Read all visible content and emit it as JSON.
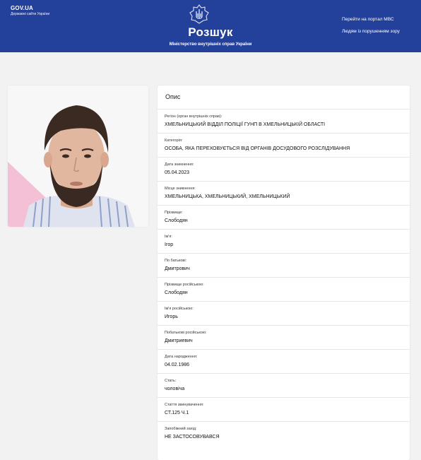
{
  "header": {
    "gov_title": "GOV.UA",
    "gov_subtitle": "Державні сайти України",
    "emblem_icon": "trident-emblem-icon",
    "title": "Розшук",
    "subtitle": "Міністерство внутрішніх справ України",
    "nav": [
      {
        "label": "Перейти на портал МВС"
      },
      {
        "label": "Людям із порушенням зору"
      }
    ],
    "bg_color": "#23409a"
  },
  "photo": {
    "icon": "person-photo"
  },
  "details": {
    "title": "Опис",
    "fields": [
      {
        "label": "Регіон (орган внутрішніх справ):",
        "value": "ХМЕЛЬНИЦЬКИЙ ВІДДІЛ ПОЛІЦІЇ ГУНП В ХМЕЛЬНИЦЬКІЙ ОБЛАСТІ"
      },
      {
        "label": "Категорія:",
        "value": "ОСОБА, ЯКА ПЕРЕХОВУЄТЬСЯ ВІД ОРГАНІВ ДОСУДОВОГО РОЗСЛІДУВАННЯ"
      },
      {
        "label": "Дата зникнення:",
        "value": "05.04.2023"
      },
      {
        "label": "Місце зникнення:",
        "value": "ХМЕЛЬНИЦЬКА, ХМЕЛЬНИЦЬКИЙ, ХМЕЛЬНИЦЬКИЙ"
      },
      {
        "label": "Прізвище:",
        "value": "Слободян"
      },
      {
        "label": "Ім'я:",
        "value": "Ігор"
      },
      {
        "label": "По батькові:",
        "value": "Дмитрович"
      },
      {
        "label": "Прізвище російською:",
        "value": "Слободян"
      },
      {
        "label": "Ім'я російською:",
        "value": "Игорь"
      },
      {
        "label": "Побатькові російською:",
        "value": "Дмитриевич"
      },
      {
        "label": "Дата народження:",
        "value": "04.02.1986"
      },
      {
        "label": "Стать:",
        "value": "чоловіча"
      },
      {
        "label": "Стаття звинувачення:",
        "value": "СТ.125 Ч.1"
      },
      {
        "label": "Запобіжний захід:",
        "value": "НЕ ЗАСТОСОВУВАВСЯ"
      }
    ]
  }
}
